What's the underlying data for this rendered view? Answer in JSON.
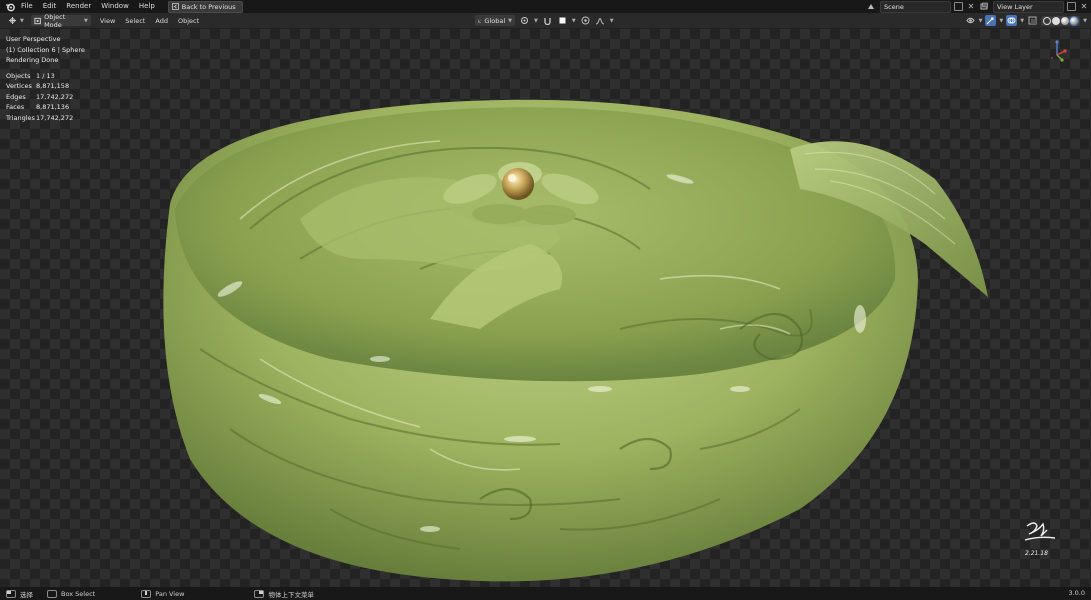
{
  "menubar": {
    "items": [
      "File",
      "Edit",
      "Render",
      "Window",
      "Help"
    ],
    "back_button": "Back to Previous",
    "scene": "Scene",
    "view_layer": "View Layer"
  },
  "header": {
    "mode": "Object Mode",
    "menus": [
      "View",
      "Select",
      "Add",
      "Object"
    ],
    "orientation": "Global"
  },
  "viewport": {
    "perspective": "User Perspective",
    "collection": "(1) Collection 6 | Sphere",
    "render_status": "Rendering Done",
    "stats": [
      {
        "label": "Objects",
        "value": "1 / 13"
      },
      {
        "label": "Vertices",
        "value": "8,871,158"
      },
      {
        "label": "Edges",
        "value": "17,742,272"
      },
      {
        "label": "Faces",
        "value": "8,871,136"
      },
      {
        "label": "Triangles",
        "value": "17,742,272"
      }
    ],
    "gizmo_axes": [
      "X",
      "Y",
      "Z"
    ],
    "signature_date": "2.21.18",
    "colors": {
      "jade_light": "#c4d48f",
      "jade_mid": "#9db35f",
      "jade_dark": "#5f7636",
      "pearl": "#c9a65a"
    }
  },
  "statusbar": {
    "left_label": "选择",
    "box_select": "Box Select",
    "pan_view": "Pan View",
    "context_menu": "物体上下文菜单",
    "version": "3.0.0"
  }
}
